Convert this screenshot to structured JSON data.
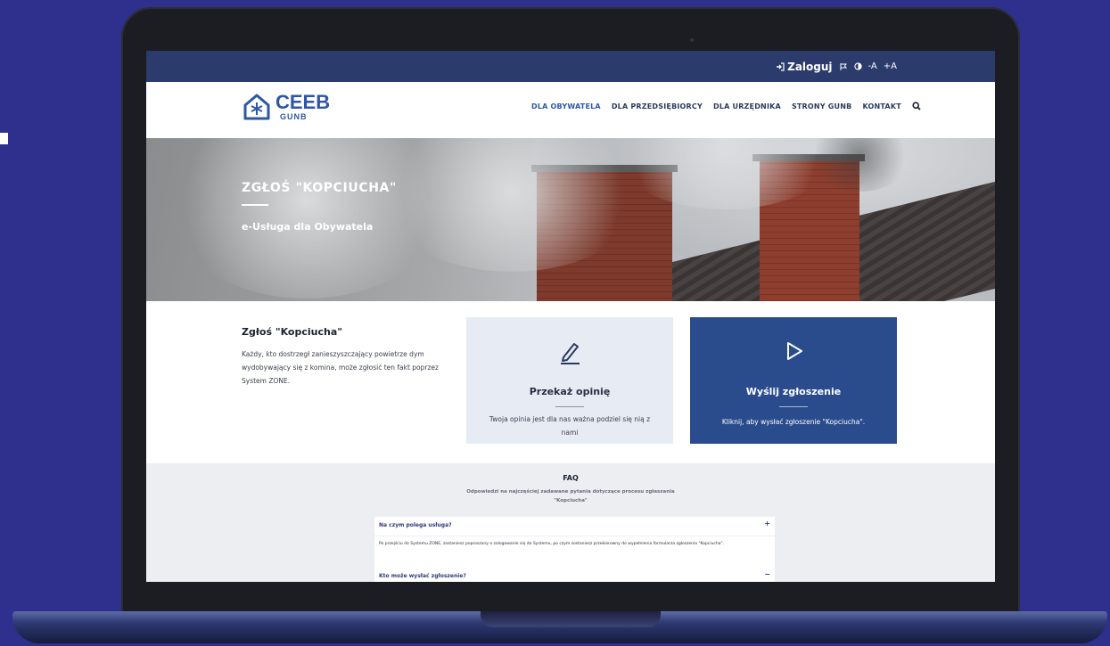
{
  "topbar": {
    "login_label": "Zaloguj",
    "icons": [
      "login-icon",
      "flag-icon",
      "contrast-icon",
      "font-decrease-icon",
      "font-increase-icon"
    ],
    "font_small": "A",
    "font_large": "A"
  },
  "logo": {
    "name": "CEEB",
    "sub": "GUNB"
  },
  "nav": {
    "items": [
      "DLA OBYWATELA",
      "DLA PRZEDSIĘBIORCY",
      "DLA URZĘDNIKA",
      "STRONY GUNB",
      "KONTAKT"
    ],
    "active_index": 0
  },
  "hero": {
    "title": "ZGŁOŚ \"KOPCIUCHA\"",
    "subtitle": "e-Usługa dla Obywatela"
  },
  "intro": {
    "title": "Zgłoś \"Kopciucha\"",
    "text": "Każdy, kto dostrzegł zanieszyszczający powietrze dym wydobywający się z komina, może zgłosić ten fakt poprzez System ZONE."
  },
  "cards": {
    "opinion": {
      "title": "Przekaż opinię",
      "text": "Twoja opinia jest dla nas ważna podziel się nią z nami",
      "icon": "pencil-icon"
    },
    "send": {
      "title": "Wyślij zgłoszenie",
      "text": "Kliknij, aby wysłać zgłoszenie \"Kopciucha\".",
      "icon": "play-icon"
    }
  },
  "faq": {
    "title": "FAQ",
    "subtitle": "Odpowiedzi na najczęściej zadawane pytania dotyczące procesu zgłaszania \"Kopciucha\"",
    "items": [
      {
        "question": "Na czym polega usługa?",
        "toggle": "+",
        "answer": "Po przejściu do Systemu ZONE, zostaniesz poproszony o zalogowanie się do Systemu, po czym zostaniesz przekierowny do wypełnienia formularza zgłoszenia \"Kopciucha\"."
      },
      {
        "question": "Kto może wysłać zgłoszenie?",
        "toggle": "−"
      }
    ]
  },
  "colors": {
    "background": "#2f2f8e",
    "topbar": "#2b3b6c",
    "brand": "#2d57a6",
    "card_send": "#2b4c8c",
    "card_opinion": "#e6ebf4"
  }
}
